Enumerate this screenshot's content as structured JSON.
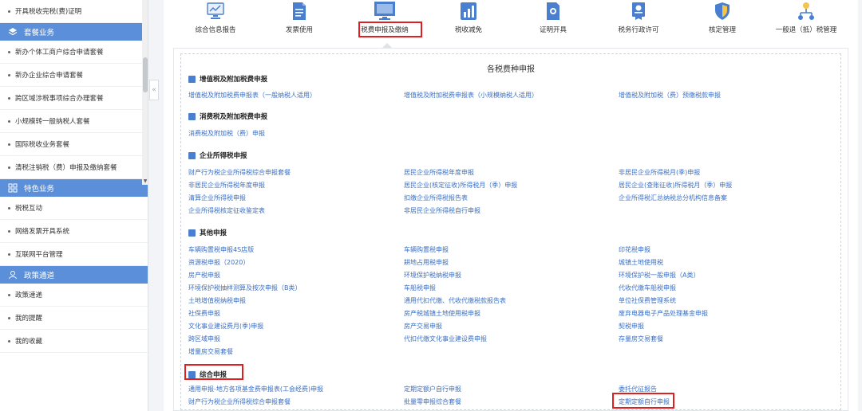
{
  "sidebar": {
    "top_item": "开具税收完税(费)证明",
    "groups": [
      {
        "label": "套餐业务",
        "items": [
          "新办个体工商户综合申请套餐",
          "新办企业综合申请套餐",
          "跨区域涉税事项综合办理套餐",
          "小规模转一般纳税人套餐",
          "国际税收业务套餐",
          "清税注销税（费）申报及缴纳套餐"
        ]
      },
      {
        "label": "特色业务",
        "items": [
          "税税互动",
          "网络发票开具系统",
          "互联网平台管理"
        ]
      },
      {
        "label": "政策通道",
        "items": [
          "政策速递",
          "我的提醒",
          "我的收藏"
        ]
      }
    ]
  },
  "nav": [
    {
      "label": "综合信息报告",
      "icon": "monitor-chart-icon"
    },
    {
      "label": "发票使用",
      "icon": "document-icon"
    },
    {
      "label": "税费申报及缴纳",
      "icon": "screen-icon"
    },
    {
      "label": "税收减免",
      "icon": "bar-chart-icon"
    },
    {
      "label": "证明开具",
      "icon": "certificate-icon"
    },
    {
      "label": "税务行政许可",
      "icon": "badge-icon"
    },
    {
      "label": "核定管理",
      "icon": "shield-icon"
    },
    {
      "label": "一般退（抵）税管理",
      "icon": "org-chart-icon"
    }
  ],
  "panel_title": "各税费种申报",
  "sections": {
    "vat": {
      "title": "增值税及附加税费申报",
      "links": [
        "增值税及附加税费申报表（一般纳税人适用）",
        "增值税及附加税费申报表（小规模纳税人适用）",
        "增值税及附加税（费）预缴税款申报"
      ]
    },
    "consumption": {
      "title": "消费税及附加税费申报",
      "links": [
        "消费税及附加税（费）申报"
      ]
    },
    "cit": {
      "title": "企业所得税申报",
      "links": [
        "财产行为税企业所得税综合申报套餐",
        "居民企业所得税年度申报",
        "非居民企业所得税月(季)申报",
        "非居民企业所得税年度申报",
        "居民企业(核定征收)所得税月（季）申报",
        "居民企业(查账征收)所得税月（季）申报",
        "清算企业所得税申报",
        "扣缴企业所得税报告表",
        "企业所得税汇总纳税总分机构信息备案",
        "企业所得税核定征收鉴定表",
        "非居民企业所得税自行申报"
      ]
    },
    "other": {
      "title": "其他申报",
      "links": [
        "车辆购置税申报4S店版",
        "车辆购置税申报",
        "印花税申报",
        "资源税申报（2020）",
        "耕地占用税申报",
        "城镇土地使用税",
        "房产税申报",
        "环境保护税纳税申报",
        "环境保护税一般申报（A类）",
        "环境保护税抽样测算及按次申报（B类）",
        "车船税申报",
        "代收代缴车船税申报",
        "土地增值税纳税申报",
        "通用代扣代缴、代收代缴税款报告表",
        "单位社保费管理系统",
        "社保费申报",
        "房产税城镇土地使用税申报",
        "废弃电器电子产品处理基金申报",
        "文化事业建设费月(季)申报",
        "房产交易申报",
        "契税申报",
        "跨区域申报",
        "代扣代缴文化事业建设费申报",
        "存量房交易套餐",
        "增量房交易套餐"
      ]
    },
    "comprehensive": {
      "title": "综合申报",
      "links": [
        "通用申报-地方各项基金费申报表(工会经费)申报",
        "定期定额户自行申报",
        "委托代征报告",
        "财产行为税企业所得税综合申报套餐",
        "批量零申报综合套餐",
        "定期定额自行申报"
      ]
    }
  }
}
